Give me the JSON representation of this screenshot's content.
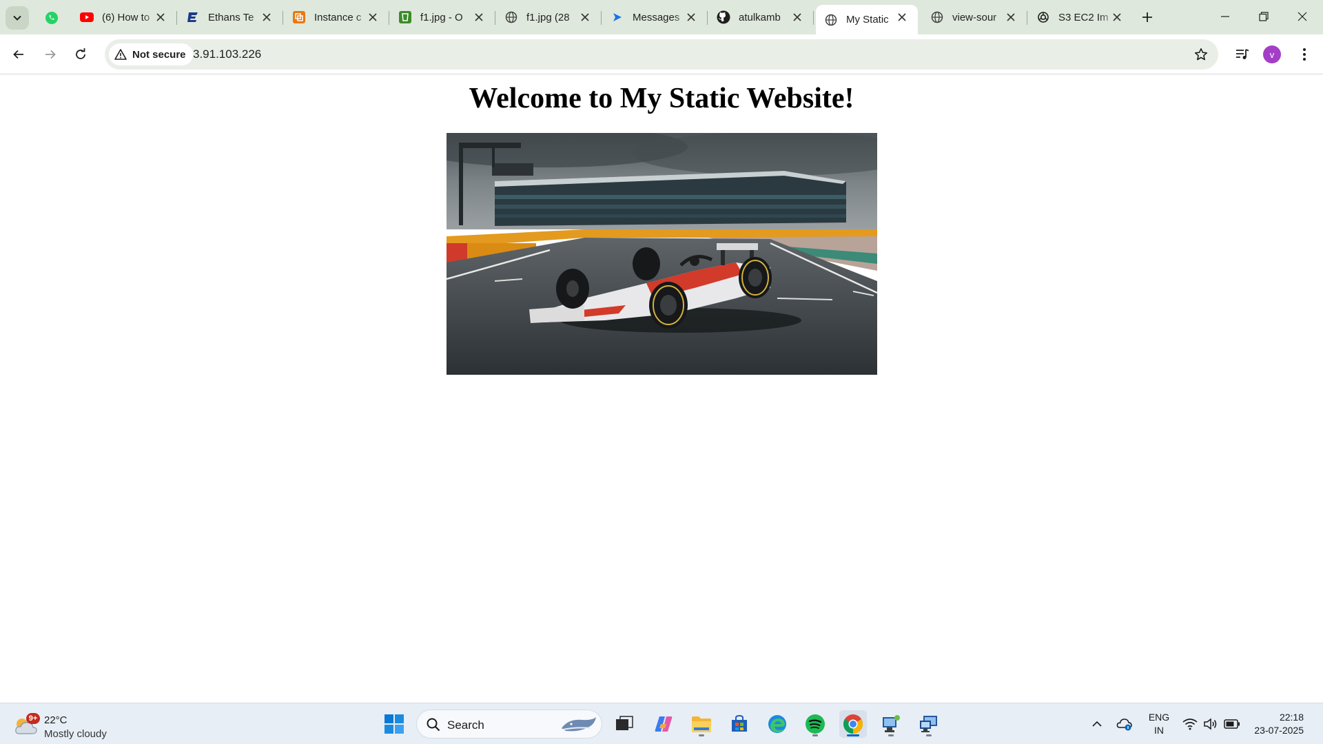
{
  "browser": {
    "tabs": [
      {
        "title": "(6) How to",
        "icon": "youtube-icon",
        "active": false
      },
      {
        "title": "Ethans Te",
        "icon": "ethans-icon",
        "active": false
      },
      {
        "title": "Instance c",
        "icon": "aws-icon",
        "active": false
      },
      {
        "title": "f1.jpg - O",
        "icon": "s3-icon",
        "active": false
      },
      {
        "title": "f1.jpg (28",
        "icon": "globe-icon",
        "active": false
      },
      {
        "title": "Messages",
        "icon": "messages-icon",
        "active": false
      },
      {
        "title": "atulkamb",
        "icon": "github-icon",
        "active": false
      },
      {
        "title": "My Static",
        "icon": "globe-icon",
        "active": true
      },
      {
        "title": "view-sour",
        "icon": "globe-icon",
        "active": false
      },
      {
        "title": "S3 EC2 Im",
        "icon": "chatgpt-icon",
        "active": false
      }
    ],
    "security_label": "Not secure",
    "url": "3.91.103.226",
    "profile_initial": "v"
  },
  "page": {
    "heading": "Welcome to My Static Website!"
  },
  "taskbar": {
    "weather_badge": "9+",
    "temperature": "22°C",
    "condition": "Mostly cloudy",
    "search_label": "Search",
    "lang_line1": "ENG",
    "lang_line2": "IN",
    "time": "22:18",
    "date": "23-07-2025"
  },
  "colors": {
    "tabstrip_bg": "#dfe8dc",
    "omnibox_bg": "#e9efe7",
    "profile_bg": "#a33fc7",
    "taskbar_bg": "#e7eef6",
    "accent_blue": "#0067c0"
  }
}
